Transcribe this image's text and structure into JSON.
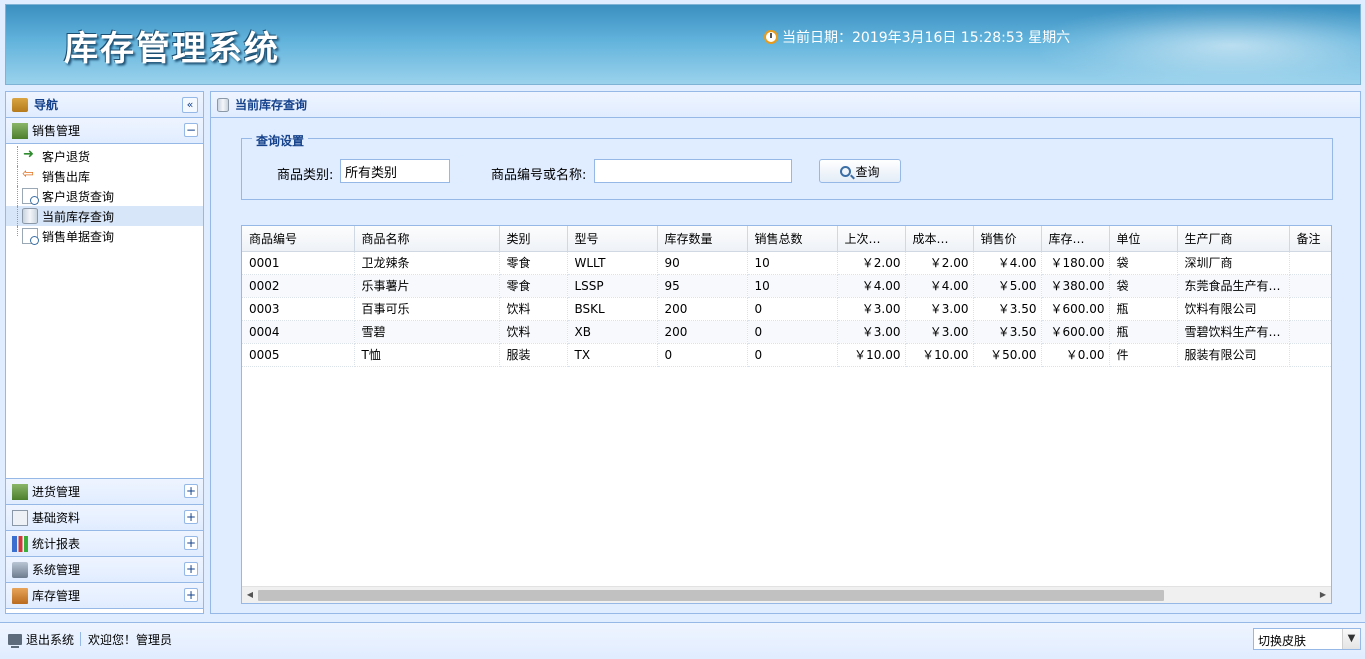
{
  "header": {
    "system_name": "库存管理系统",
    "clock_label": "当前日期：2019年3月16日 15:28:53 星期六"
  },
  "nav": {
    "title": "导航",
    "sections": [
      {
        "label": "销售管理",
        "icon": "sales-icon",
        "expanded": true,
        "items": [
          {
            "label": "客户退货",
            "icon": "return-arrow-icon"
          },
          {
            "label": "销售出库",
            "icon": "outbound-arrow-icon"
          },
          {
            "label": "客户退货查询",
            "icon": "document-search-icon"
          },
          {
            "label": "当前库存查询",
            "icon": "database-icon",
            "selected": true
          },
          {
            "label": "销售单据查询",
            "icon": "document-search-icon"
          }
        ]
      },
      {
        "label": "进货管理",
        "icon": "purchase-icon"
      },
      {
        "label": "基础资料",
        "icon": "base-data-icon"
      },
      {
        "label": "统计报表",
        "icon": "chart-icon"
      },
      {
        "label": "系统管理",
        "icon": "system-icon"
      },
      {
        "label": "库存管理",
        "icon": "inventory-icon"
      }
    ]
  },
  "main": {
    "title": "当前库存查询",
    "query": {
      "legend": "查询设置",
      "category_label": "商品类别:",
      "category_value": "所有类别",
      "keyword_label": "商品编号或名称:",
      "keyword_value": "",
      "search_label": "查询"
    },
    "table": {
      "columns": [
        "商品编号",
        "商品名称",
        "类别",
        "型号",
        "库存数量",
        "销售总数",
        "上次…",
        "成本…",
        "销售价",
        "库存…",
        "单位",
        "生产厂商",
        "备注"
      ],
      "rows": [
        [
          "0001",
          "卫龙辣条",
          "零食",
          "WLLT",
          "90",
          "10",
          "￥2.00",
          "￥2.00",
          "￥4.00",
          "￥180.00",
          "袋",
          "深圳厂商",
          ""
        ],
        [
          "0002",
          "乐事薯片",
          "零食",
          "LSSP",
          "95",
          "10",
          "￥4.00",
          "￥4.00",
          "￥5.00",
          "￥380.00",
          "袋",
          "东莞食品生产有…",
          ""
        ],
        [
          "0003",
          "百事可乐",
          "饮料",
          "BSKL",
          "200",
          "0",
          "￥3.00",
          "￥3.00",
          "￥3.50",
          "￥600.00",
          "瓶",
          "饮料有限公司",
          ""
        ],
        [
          "0004",
          "雪碧",
          "饮料",
          "XB",
          "200",
          "0",
          "￥3.00",
          "￥3.00",
          "￥3.50",
          "￥600.00",
          "瓶",
          "雪碧饮料生产有…",
          ""
        ],
        [
          "0005",
          "T恤",
          "服装",
          "TX",
          "0",
          "0",
          "￥10.00",
          "￥10.00",
          "￥50.00",
          "￥0.00",
          "件",
          "服装有限公司",
          ""
        ]
      ]
    }
  },
  "footer": {
    "exit_label": "退出系统",
    "welcome": "欢迎您！管理员",
    "skin_label": "切换皮肤"
  }
}
